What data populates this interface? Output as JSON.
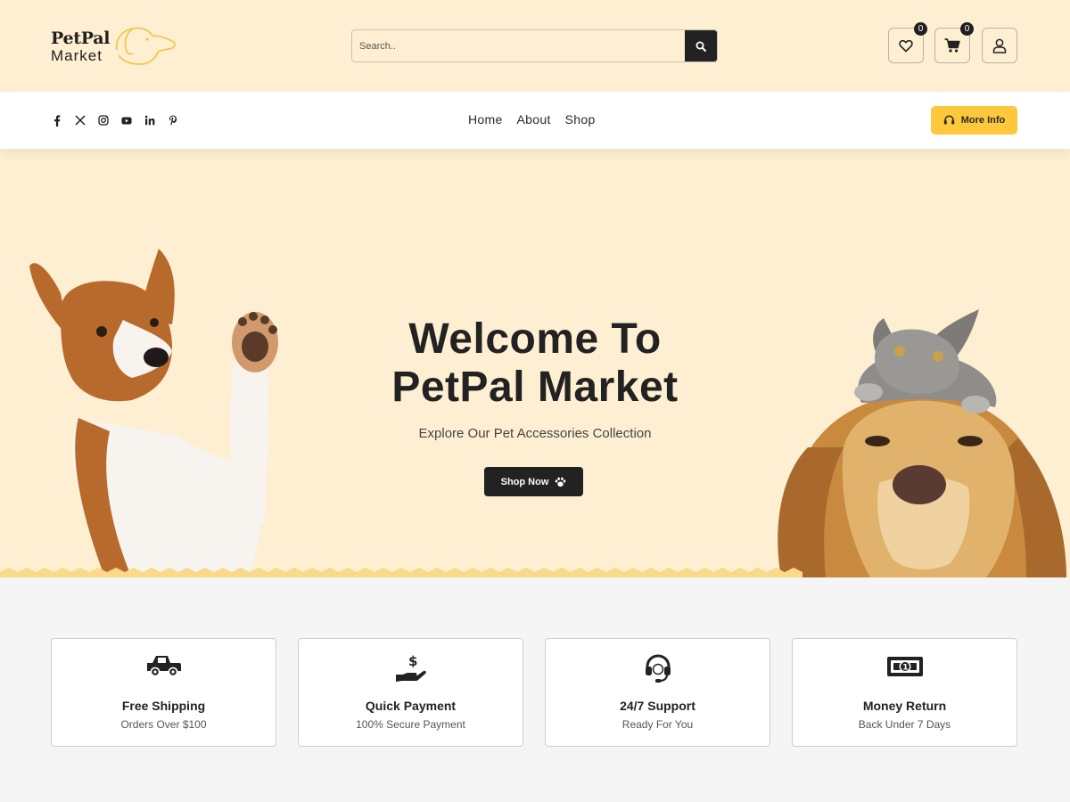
{
  "brand": {
    "line1": "PetPal",
    "line2": "Market"
  },
  "search": {
    "placeholder": "Search.."
  },
  "header_icons": {
    "wishlist_count": "0",
    "cart_count": "0"
  },
  "socials": [
    "facebook-icon",
    "x-twitter-icon",
    "instagram-icon",
    "youtube-icon",
    "linkedin-icon",
    "pinterest-icon"
  ],
  "nav": {
    "items": [
      {
        "label": "Home"
      },
      {
        "label": "About"
      },
      {
        "label": "Shop"
      }
    ],
    "more_info": "More Info"
  },
  "hero": {
    "title_line1": "Welcome To",
    "title_line2": "PetPal Market",
    "subtitle": "Explore Our Pet Accessories Collection",
    "cta": "Shop Now"
  },
  "features": [
    {
      "icon": "truck-icon",
      "title": "Free Shipping",
      "subtitle": "Orders Over $100"
    },
    {
      "icon": "payment-hand-icon",
      "title": "Quick Payment",
      "subtitle": "100% Secure Payment"
    },
    {
      "icon": "headset-icon",
      "title": "24/7 Support",
      "subtitle": "Ready For You"
    },
    {
      "icon": "money-bill-icon",
      "title": "Money Return",
      "subtitle": "Back Under 7 Days"
    }
  ],
  "colors": {
    "cream": "#feefd2",
    "accent": "#fdc83b",
    "dark": "#222222",
    "zigzag": "#f9d98a"
  }
}
